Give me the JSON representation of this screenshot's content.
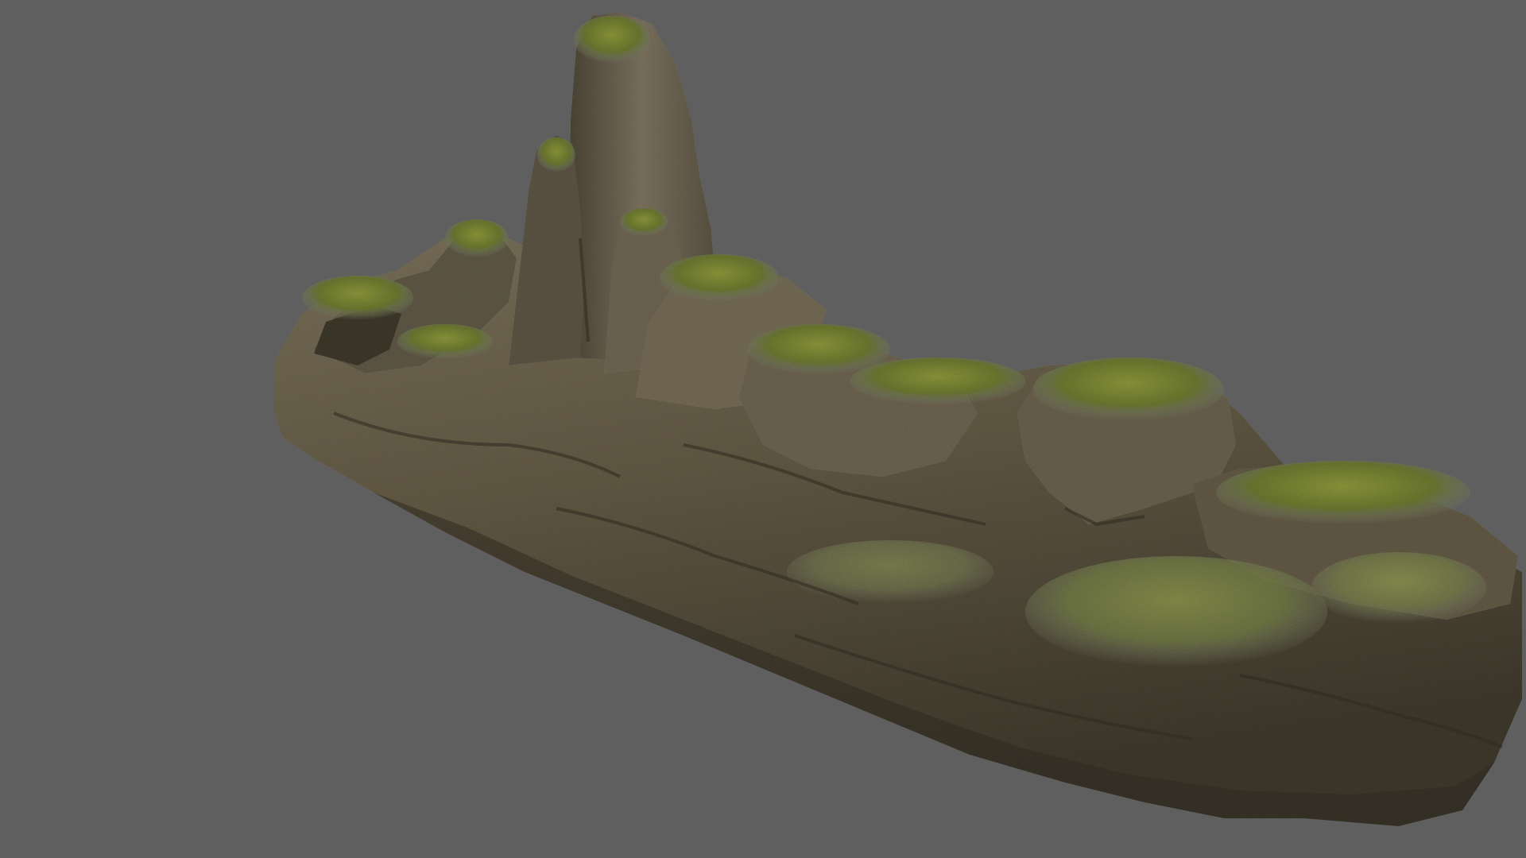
{
  "scene": {
    "subject_icon": "moss-covered-rock-formation",
    "background_color": "#5f5f5f",
    "colors": {
      "rock_dark": "#3f3a2c",
      "rock_mid": "#6b6149",
      "rock_light": "#8d826a",
      "moss_dark": "#4f5a22",
      "moss_mid": "#6f7b2c",
      "moss_light": "#8a9636",
      "shadow": "#2c281f"
    }
  }
}
